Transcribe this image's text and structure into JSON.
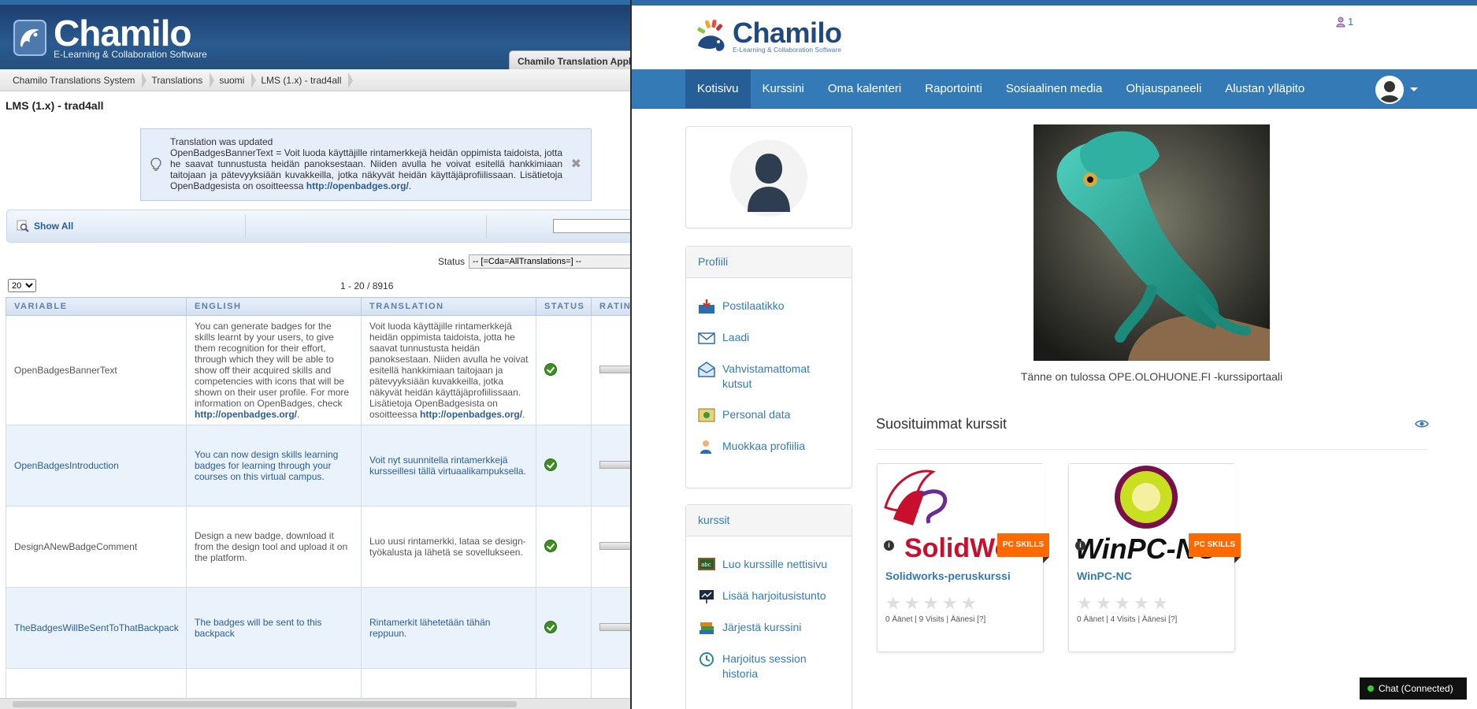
{
  "left": {
    "brand": "Chamilo",
    "tagline": "E-Learning & Collaboration Software",
    "app_tab": "Chamilo Translation Application",
    "breadcrumbs": [
      "Chamilo Translations System",
      "Translations",
      "suomi",
      "LMS (1.x) - trad4all"
    ],
    "page_title": "LMS (1.x) - trad4all",
    "notice": {
      "line1": "Translation was updated",
      "body": "OpenBadgesBannerText = Voit luoda käyttäjille rintamerkkejä heidän oppimista taidoista, jotta he saavat tunnustusta heidän panoksestaan. Niiden avulla he voivat esitellä hankkimiaan taitojaan ja pätevyyksiään kuvakkeilla, jotka näkyvät heidän käyttäjäprofiilissaan. Lisätietoja OpenBadgesista on osoitteessa ",
      "link": "http://openbadges.org/",
      "tail": "."
    },
    "toolbar": {
      "show_all": "Show All"
    },
    "status": {
      "label": "Status",
      "value": "-- [=Cda=AllTranslations=] --"
    },
    "pager": {
      "per_page": "20",
      "count": "1 - 20 / 8916"
    },
    "columns": [
      "VARIABLE",
      "ENGLISH",
      "TRANSLATION",
      "STATUS",
      "RATING"
    ],
    "rows": [
      {
        "variable": "OpenBadgesBannerText",
        "english": "You can generate badges for the skills learnt by your users, to give them recognition for their effort, through which they will be able to show off their acquired skills and competencies with icons that will be shown on their user profile. For more information on OpenBadges, check ",
        "english_link": "http://openbadges.org/",
        "translation": "Voit luoda käyttäjille rintamerkkejä heidän oppimista taidoista, jotta he saavat tunnustusta heidän panoksestaan. Niiden avulla he voivat esitellä hankkimiaan taitojaan ja pätevyyksiään kuvakkeilla, jotka näkyvät heidän käyttäjäprofiilissaan. Lisätietoja OpenBadgesista on osoitteessa ",
        "translation_link": "http://openbadges.org/"
      },
      {
        "variable": "OpenBadgesIntroduction",
        "english": "You can now design skills learning badges for learning through your courses on this virtual campus.",
        "translation": "Voit nyt suunnitella rintamerkkejä kursseillesi tällä virtuaalikampuksella."
      },
      {
        "variable": "DesignANewBadgeComment",
        "english": "Design a new badge, download it from the design tool and upload it on the platform.",
        "translation": "Luo uusi rintamerkki, lataa se design-työkalusta ja lähetä se sovellukseen."
      },
      {
        "variable": "TheBadgesWillBeSentToThatBackpack",
        "english": "The badges will be sent to this backpack",
        "translation": "Rintamerkit lähetetään tähän reppuun."
      }
    ]
  },
  "right": {
    "brand": "Chamilo",
    "tagline": "E-Learning & Collaboration Software",
    "user_count": "1",
    "nav": [
      "Kotisivu",
      "Kurssini",
      "Oma kalenteri",
      "Raportointi",
      "Sosiaalinen media",
      "Ohjauspaneeli",
      "Alustan ylläpito"
    ],
    "profile_panel": {
      "title": "Profiili",
      "items": [
        "Postilaatikko",
        "Laadi",
        "Vahvistamattomat kutsut",
        "Personal data",
        "Muokkaa profiilia"
      ]
    },
    "courses_panel": {
      "title": "kurssit",
      "items": [
        "Luo kurssille nettisivu",
        "Lisää harjoitusistunto",
        "Järjestä kurssini",
        "Harjoitus session historia"
      ]
    },
    "caption": "Tänne on tulossa OPE.OLOHUONE.FI -kurssiportaali",
    "popular_title": "Suosituimmat kurssit",
    "cards": [
      {
        "title": "Solidworks-peruskurssi",
        "ribbon": "PC SKILLS",
        "meta": "0 Äänet | 9 Visits | Äänesi [?]",
        "logo_text": "SolidWorks"
      },
      {
        "title": "WinPC-NC",
        "ribbon": "PC SKILLS",
        "meta": "0 Äänet | 4 Visits | Äänesi [?]",
        "logo_text": "WinPC-NC"
      }
    ],
    "chat": "Chat (Connected)"
  },
  "colors": {
    "nav": "#337ab7",
    "nav_active": "#255f95",
    "ribbon": "#ff6a00",
    "left_header": "#1d3f6f"
  }
}
